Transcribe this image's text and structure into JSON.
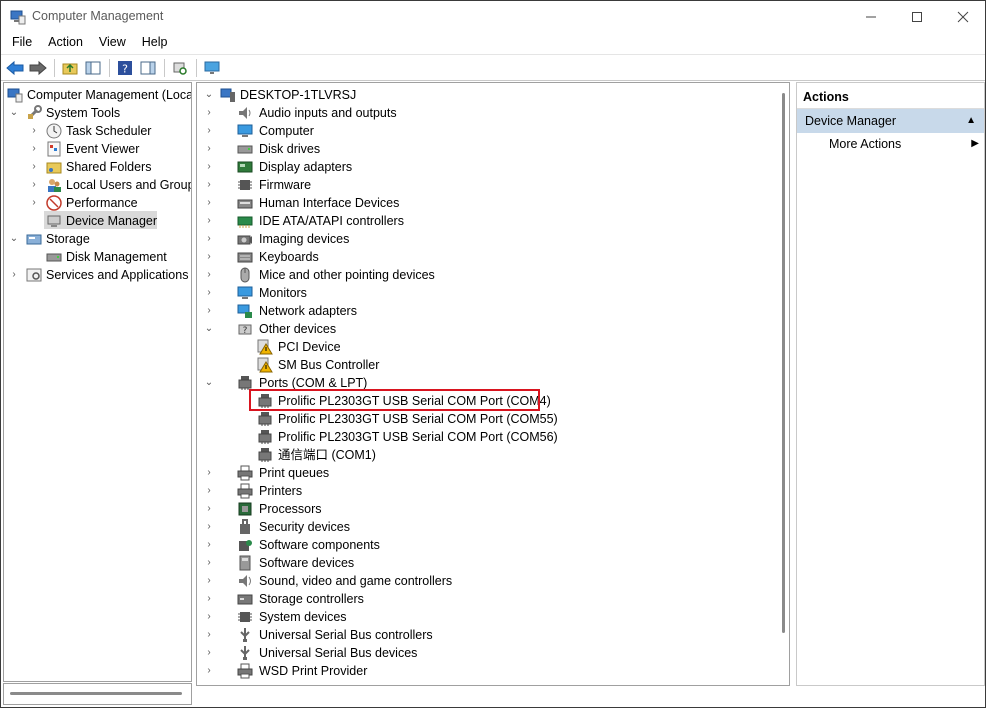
{
  "window": {
    "title": "Computer Management"
  },
  "menu": [
    "File",
    "Action",
    "View",
    "Help"
  ],
  "left_tree": {
    "root": "Computer Management (Local",
    "system_tools": "System Tools",
    "task_scheduler": "Task Scheduler",
    "event_viewer": "Event Viewer",
    "shared_folders": "Shared Folders",
    "local_users": "Local Users and Groups",
    "performance": "Performance",
    "device_manager": "Device Manager",
    "storage": "Storage",
    "disk_management": "Disk Management",
    "services": "Services and Applications"
  },
  "devices": {
    "computer_name": "DESKTOP-1TLVRSJ",
    "categories": [
      "Audio inputs and outputs",
      "Computer",
      "Disk drives",
      "Display adapters",
      "Firmware",
      "Human Interface Devices",
      "IDE ATA/ATAPI controllers",
      "Imaging devices",
      "Keyboards",
      "Mice and other pointing devices",
      "Monitors",
      "Network adapters",
      "Other devices",
      "PCI Device",
      "SM Bus Controller",
      "Ports (COM & LPT)",
      "Prolific PL2303GT USB Serial COM Port (COM4)",
      "Prolific PL2303GT USB Serial COM Port (COM55)",
      "Prolific PL2303GT USB Serial COM Port (COM56)",
      "通信端口 (COM1)",
      "Print queues",
      "Printers",
      "Processors",
      "Security devices",
      "Software components",
      "Software devices",
      "Sound, video and game controllers",
      "Storage controllers",
      "System devices",
      "Universal Serial Bus controllers",
      "Universal Serial Bus devices",
      "WSD Print Provider"
    ]
  },
  "actions": {
    "header": "Actions",
    "section": "Device Manager",
    "more": "More Actions"
  },
  "colors": {
    "highlight": "#d9141f",
    "section_bg": "#c8d9ea",
    "selected_bg": "#d9d9d9"
  }
}
